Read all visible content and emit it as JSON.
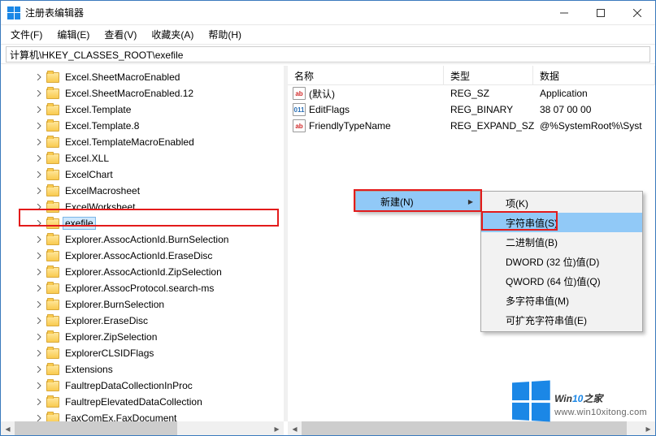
{
  "window": {
    "title": "注册表编辑器"
  },
  "menu": {
    "file": "文件(F)",
    "edit": "编辑(E)",
    "view": "查看(V)",
    "fav": "收藏夹(A)",
    "help": "帮助(H)"
  },
  "address": "计算机\\HKEY_CLASSES_ROOT\\exefile",
  "tree": [
    "Excel.SheetMacroEnabled",
    "Excel.SheetMacroEnabled.12",
    "Excel.Template",
    "Excel.Template.8",
    "Excel.TemplateMacroEnabled",
    "Excel.XLL",
    "ExcelChart",
    "ExcelMacrosheet",
    "ExcelWorksheet",
    "exefile",
    "Explorer.AssocActionId.BurnSelection",
    "Explorer.AssocActionId.EraseDisc",
    "Explorer.AssocActionId.ZipSelection",
    "Explorer.AssocProtocol.search-ms",
    "Explorer.BurnSelection",
    "Explorer.EraseDisc",
    "Explorer.ZipSelection",
    "ExplorerCLSIDFlags",
    "Extensions",
    "FaultrepDataCollectionInProc",
    "FaultrepElevatedDataCollection",
    "FaxComEx.FaxDocument"
  ],
  "selected_index": 9,
  "list": {
    "headers": {
      "name": "名称",
      "type": "类型",
      "data": "数据"
    },
    "rows": [
      {
        "icon": "str",
        "name": "(默认)",
        "type": "REG_SZ",
        "data": "Application"
      },
      {
        "icon": "bin",
        "name": "EditFlags",
        "type": "REG_BINARY",
        "data": "38 07 00 00"
      },
      {
        "icon": "str",
        "name": "FriendlyTypeName",
        "type": "REG_EXPAND_SZ",
        "data": "@%SystemRoot%\\Syst"
      }
    ]
  },
  "ctx1": {
    "new": "新建(N)"
  },
  "ctx2": {
    "key": "项(K)",
    "string": "字符串值(S)",
    "binary": "二进制值(B)",
    "dword": "DWORD (32 位)值(D)",
    "qword": "QWORD (64 位)值(Q)",
    "multi": "多字符串值(M)",
    "expand": "可扩充字符串值(E)"
  },
  "watermark": {
    "brand_a": "Win",
    "brand_b": "10",
    "brand_c": "之家",
    "url": "www.win10xitong.com"
  }
}
